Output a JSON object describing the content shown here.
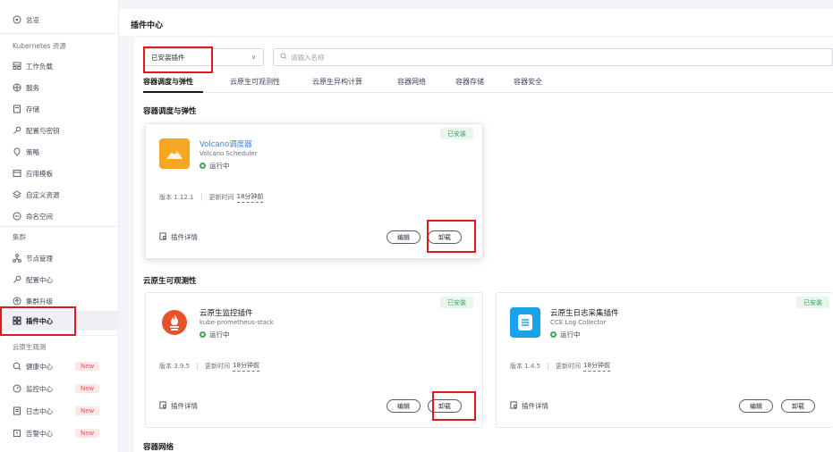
{
  "sidebar": {
    "overview": "总览",
    "k8s_group": "Kubernetes 资源",
    "k8s_items": [
      {
        "label": "工作负载",
        "icon": "workload-icon"
      },
      {
        "label": "服务",
        "icon": "globe-icon"
      },
      {
        "label": "存储",
        "icon": "storage-icon"
      },
      {
        "label": "配置与密钥",
        "icon": "key-icon"
      },
      {
        "label": "策略",
        "icon": "policy-icon"
      },
      {
        "label": "应用模板",
        "icon": "template-icon"
      },
      {
        "label": "自定义资源",
        "icon": "layers-icon"
      },
      {
        "label": "命名空间",
        "icon": "namespace-icon"
      }
    ],
    "cluster_group": "集群",
    "cluster_items": [
      {
        "label": "节点管理",
        "icon": "node-icon"
      },
      {
        "label": "配置中心",
        "icon": "config-icon"
      },
      {
        "label": "集群升级",
        "icon": "upgrade-icon"
      },
      {
        "label": "插件中心",
        "icon": "grid-icon"
      }
    ],
    "obs_group": "云原生观测",
    "obs_items": [
      {
        "label": "健康中心",
        "icon": "health-icon",
        "badge": "New"
      },
      {
        "label": "监控中心",
        "icon": "monitor-icon",
        "badge": "New"
      },
      {
        "label": "日志中心",
        "icon": "log-icon",
        "badge": "New"
      },
      {
        "label": "告警中心",
        "icon": "alarm-icon",
        "badge": "New"
      }
    ]
  },
  "header": {
    "title": "插件中心"
  },
  "filter": {
    "select_value": "已安装插件",
    "search_placeholder": "请输入名称"
  },
  "tabs": [
    "容器调度与弹性",
    "云原生可观测性",
    "云原生异构计算",
    "容器网络",
    "容器存储",
    "容器安全"
  ],
  "sections": {
    "scheduling": "容器调度与弹性",
    "observability": "云原生可观测性",
    "network": "容器网络"
  },
  "plugins": [
    {
      "name": "Volcano调度器",
      "sub": "Volcano Scheduler",
      "status": "运行中",
      "installed": "已安装",
      "version_label": "版本",
      "version": "1.12.1",
      "updated_label": "更新时间",
      "updated": "18分钟前",
      "details": "插件详情",
      "edit": "编辑",
      "uninstall": "卸载"
    },
    {
      "name": "云原生监控插件",
      "sub": "kube-prometheus-stack",
      "status": "运行中",
      "installed": "已安装",
      "version_label": "版本",
      "version": "3.9.5",
      "updated_label": "更新时间",
      "updated": "18分钟前",
      "details": "插件详情",
      "edit": "编辑",
      "uninstall": "卸载"
    },
    {
      "name": "云原生日志采集插件",
      "sub": "CCE Log Collector",
      "status": "运行中",
      "installed": "已安装",
      "version_label": "版本",
      "version": "1.4.5",
      "updated_label": "更新时间",
      "updated": "18分钟前",
      "details": "插件详情",
      "edit": "编辑",
      "uninstall": "卸载"
    }
  ],
  "colors": {
    "accent": "#3f7fd6",
    "success": "#3da35a",
    "highlight": "#e0191f",
    "volcano": "#f5a623",
    "prometheus": "#e6522c",
    "log": "#1aa3e8"
  }
}
